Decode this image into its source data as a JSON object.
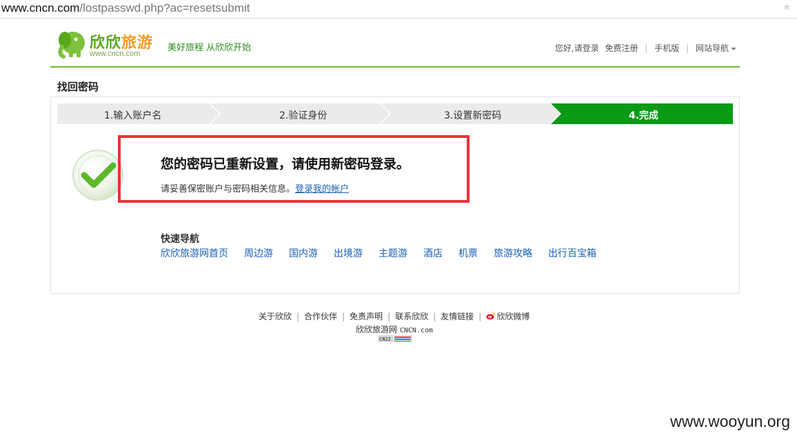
{
  "browser": {
    "url_host": "www.cncn.com",
    "url_path": "/lostpasswd.php?ac=resetsubmit"
  },
  "header": {
    "logo_brand_a": "欣欣",
    "logo_brand_b": "旅游",
    "logo_domain": "www.cncn.com",
    "slogan": "美好旅程 从欣欣开始",
    "greeting": "您好, ",
    "login": "请登录",
    "register": "免费注册",
    "mobile": "手机版",
    "site_nav": "网站导航"
  },
  "page_title": "找回密码",
  "steps": [
    {
      "label": "1.输入账户名",
      "state": "done"
    },
    {
      "label": "2.验证身份",
      "state": "done"
    },
    {
      "label": "3.设置新密码",
      "state": "done"
    },
    {
      "label": "4.完成",
      "state": "active"
    }
  ],
  "result": {
    "title": "您的密码已重新设置，请使用新密码登录。",
    "sub_text": "请妥善保密账户与密码相关信息。",
    "login_link": "登录我的帐户"
  },
  "quick_nav": {
    "title": "快速导航",
    "links": [
      "欣欣旅游网首页",
      "周边游",
      "国内游",
      "出境游",
      "主题游",
      "酒店",
      "机票",
      "旅游攻略",
      "出行百宝箱"
    ]
  },
  "footer": {
    "links": [
      "关于欣欣",
      "合作伙伴",
      "免责声明",
      "联系欣欣",
      "友情链接"
    ],
    "weibo": "欣欣微博",
    "copyright_cn": "欣欣旅游网",
    "copyright_en": "CNCN.com",
    "badge": "CN22"
  },
  "watermark": "www.wooyun.org",
  "colors": {
    "brand_green": "#6fba2c",
    "active_step": "#0a9a16",
    "step_bg": "#ebebeb",
    "link_blue": "#1a5fb4",
    "highlight_red": "#e8323a"
  }
}
